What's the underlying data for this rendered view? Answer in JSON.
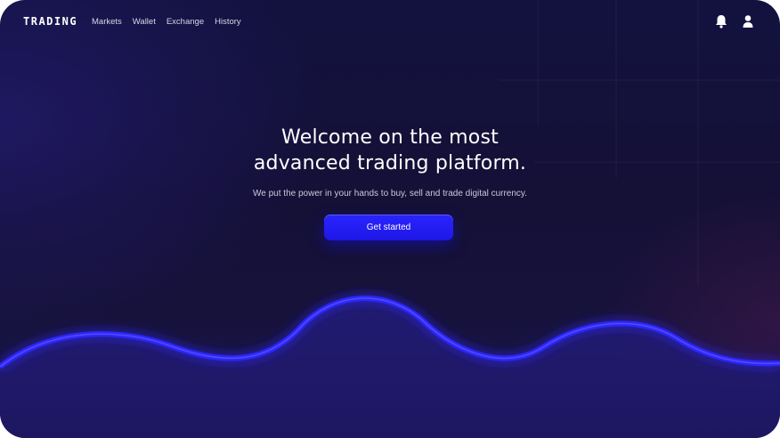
{
  "brand": {
    "logo": "TRADING"
  },
  "nav": {
    "items": [
      {
        "label": "Markets"
      },
      {
        "label": "Wallet"
      },
      {
        "label": "Exchange"
      },
      {
        "label": "History"
      }
    ]
  },
  "header_actions": {
    "notifications_icon": "bell-icon",
    "profile_icon": "user-icon"
  },
  "hero": {
    "title_line1": "Welcome on the most",
    "title_line2": "advanced trading platform.",
    "subtitle": "We put the power in your hands to buy, sell and trade digital currency.",
    "cta_label": "Get started"
  },
  "colors": {
    "accent": "#1e17e6",
    "background": "#141036",
    "wave": "#2e27ff"
  }
}
